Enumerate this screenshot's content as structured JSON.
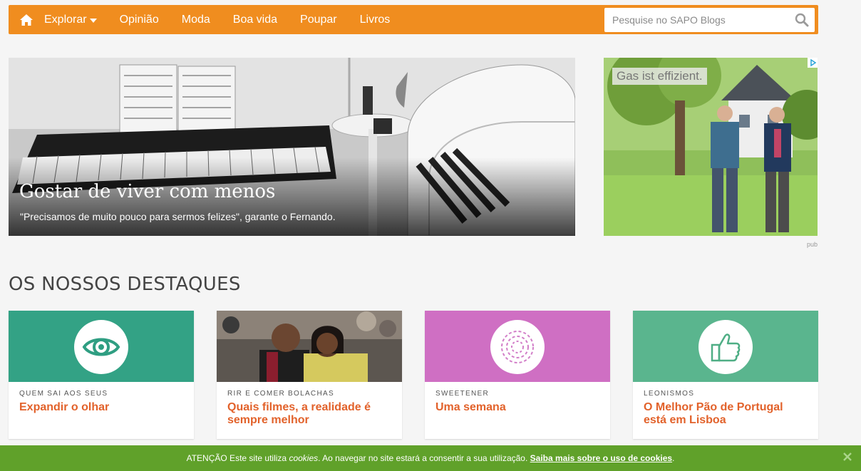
{
  "nav": {
    "home_icon": "home-icon",
    "items": [
      {
        "label": "Explorar",
        "has_dropdown": true
      },
      {
        "label": "Opinião"
      },
      {
        "label": "Moda"
      },
      {
        "label": "Boa vida"
      },
      {
        "label": "Poupar"
      },
      {
        "label": "Livros"
      }
    ],
    "search_placeholder": "Pesquise no SAPO Blogs",
    "search_icon": "search-icon",
    "bar_color": "#f08d1f"
  },
  "hero": {
    "title": "Gostar de viver com menos",
    "subtitle": "\"Precisamos de muito pouco para sermos felizes\", garante o Fernando."
  },
  "ad": {
    "text": "Gas ist effizient.",
    "pub_label": "pub"
  },
  "highlights": {
    "heading": "OS NOSSOS DESTAQUES",
    "cards": [
      {
        "category": "QUEM SAI AOS SEUS",
        "title": "Expandir o olhar",
        "color": "#33a285",
        "icon": "eye-icon"
      },
      {
        "category": "RIR E COMER BOLACHAS",
        "title": "Quais filmes, a realidade é sempre melhor",
        "color": "#7a6050",
        "icon": "photo-image"
      },
      {
        "category": "SWEETENER",
        "title": "Uma semana",
        "color": "#cf6fc3",
        "icon": "swirl-icon"
      },
      {
        "category": "LEONISMOS",
        "title": "O Melhor Pão de Portugal está em Lisboa",
        "color": "#5ab58e",
        "icon": "thumbs-up-icon"
      }
    ],
    "title_color": "#e2622b"
  },
  "cookie_bar": {
    "prefix": "ATENÇÃO Este site utiliza ",
    "italic": "cookies",
    "middle": ". Ao navegar no site estará a consentir a sua utilização. ",
    "link": "Saiba mais sobre o uso de cookies",
    "suffix": ".",
    "close_icon": "close-icon",
    "color": "#60a12a"
  }
}
